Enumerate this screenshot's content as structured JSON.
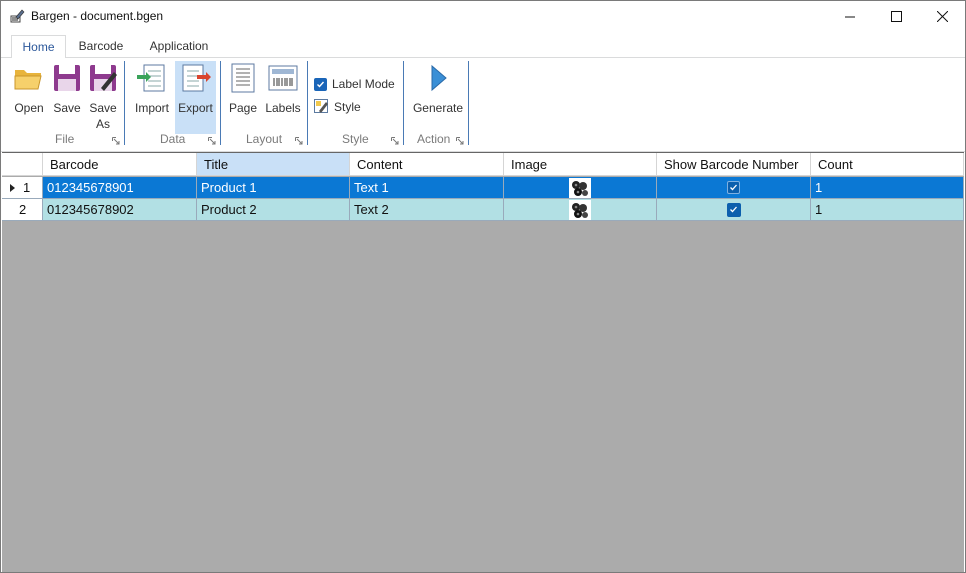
{
  "window": {
    "title": "Bargen - document.bgen",
    "app_icon": "pen-barcode-icon",
    "controls": [
      "minimize-icon",
      "maximize-icon",
      "close-icon"
    ]
  },
  "tabs": [
    {
      "label": "Home",
      "active": true
    },
    {
      "label": "Barcode",
      "active": false
    },
    {
      "label": "Application",
      "active": false
    }
  ],
  "ribbon": {
    "groups": [
      {
        "label": "File",
        "buttons": [
          {
            "label": "Open",
            "icon": "folder-open-icon"
          },
          {
            "label": "Save",
            "icon": "floppy-disk-icon"
          },
          {
            "label": "Save",
            "label2": "As",
            "icon": "floppy-pen-icon"
          }
        ]
      },
      {
        "label": "Data",
        "buttons": [
          {
            "label": "Import",
            "icon": "import-icon"
          },
          {
            "label": "Export",
            "icon": "export-icon",
            "highlighted": true
          }
        ]
      },
      {
        "label": "Layout",
        "buttons": [
          {
            "label": "Page",
            "icon": "page-icon"
          },
          {
            "label": "Labels",
            "icon": "labels-icon"
          }
        ]
      },
      {
        "label": "Style",
        "items": [
          {
            "label": "Label Mode",
            "checked": true,
            "icon": "checkbox-icon"
          },
          {
            "label": "Style",
            "icon": "style-icon"
          }
        ]
      },
      {
        "label": "Action",
        "buttons": [
          {
            "label": "Generate",
            "icon": "play-arrow-icon"
          }
        ]
      }
    ]
  },
  "grid": {
    "columns": [
      "Barcode",
      "Title",
      "Content",
      "Image",
      "Show Barcode Number",
      "Count"
    ],
    "rows": [
      {
        "num": "1",
        "barcode": "012345678901",
        "title": "Product 1",
        "content": "Text 1",
        "image": "image-thumbnail-icon",
        "show_number": true,
        "count": "1",
        "selected": true
      },
      {
        "num": "2",
        "barcode": "012345678902",
        "title": "Product 2",
        "content": "Text 2",
        "image": "image-thumbnail-icon",
        "show_number": true,
        "count": "1",
        "selected": false
      }
    ]
  },
  "colors": {
    "selected_row": "#0b78d4",
    "alt_row": "#b2e0e4",
    "empty_area": "#ababab",
    "ribbon_highlight": "#c9e0f7",
    "active_tab_text": "#2b579a"
  }
}
